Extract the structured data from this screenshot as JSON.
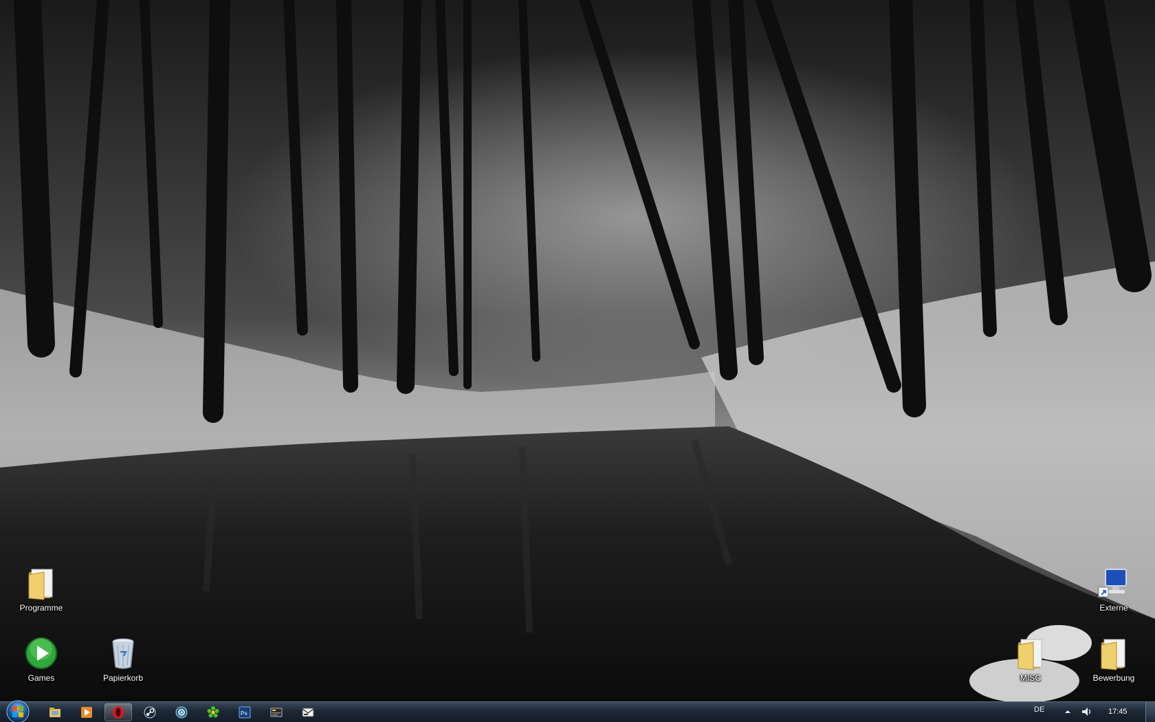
{
  "desktop": {
    "icons": [
      {
        "id": "programme",
        "label": "Programme",
        "icon": "folder-icon"
      },
      {
        "id": "externe",
        "label": "Externe",
        "icon": "computer-shortcut-icon"
      },
      {
        "id": "games",
        "label": "Games",
        "icon": "games-play-icon"
      },
      {
        "id": "papierkorb",
        "label": "Papierkorb",
        "icon": "recycle-bin-icon"
      },
      {
        "id": "misc",
        "label": "MISC",
        "icon": "folder-icon"
      },
      {
        "id": "bewerbung",
        "label": "Bewerbung",
        "icon": "folder-icon"
      }
    ]
  },
  "taskbar": {
    "start_icon": "windows-orb-icon",
    "pinned": [
      {
        "id": "explorer",
        "icon": "folder-explorer-icon",
        "active": false
      },
      {
        "id": "media-player",
        "icon": "media-player-icon",
        "active": false
      },
      {
        "id": "opera",
        "icon": "opera-icon",
        "active": true
      },
      {
        "id": "steam",
        "icon": "steam-icon",
        "active": false
      },
      {
        "id": "teamspeak",
        "icon": "voice-chat-icon",
        "active": false
      },
      {
        "id": "icq",
        "icon": "icq-flower-icon",
        "active": false
      },
      {
        "id": "photoshop",
        "icon": "photoshop-icon",
        "active": false
      },
      {
        "id": "winamp",
        "icon": "player-window-icon",
        "active": false
      },
      {
        "id": "messenger",
        "icon": "messenger-icon",
        "active": false
      }
    ],
    "tray": {
      "language": "DE",
      "clock": "17:45",
      "chevron_icon": "chevron-up-icon",
      "volume_icon": "speaker-icon"
    }
  },
  "colors": {
    "taskbar_top": "#3a4a5c",
    "taskbar_bottom": "#141d28",
    "folder": "#e8c35a",
    "games_green": "#2fa83a"
  }
}
